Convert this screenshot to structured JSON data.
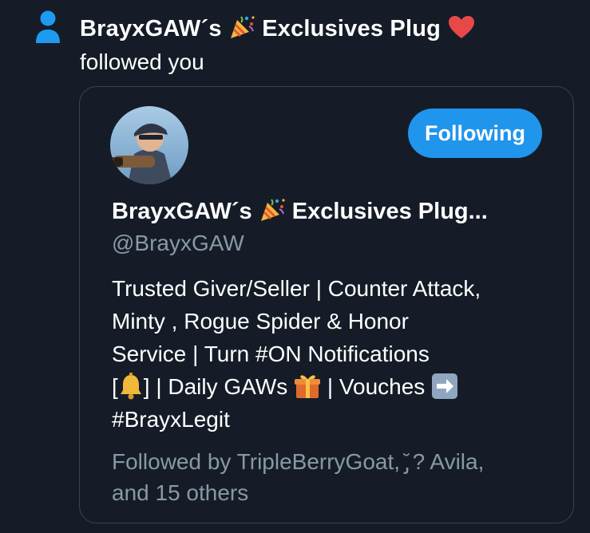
{
  "notification": {
    "icon": "person-icon",
    "name_prefix": "BrayxGAW´s",
    "name_suffix": "Exclusives Plug",
    "action": "followed you"
  },
  "card": {
    "avatar": "profile-avatar",
    "follow_button": "Following",
    "display_name_prefix": "BrayxGAW´s",
    "display_name_suffix": "Exclusives Plug...",
    "handle": "@BrayxGAW",
    "bio_lines": [
      "Trusted Giver/Seller | Counter Attack,",
      "Minty , Rogue Spider & Honor",
      "Service | Turn #ON Notifications",
      "[",
      "] | Daily GAWs",
      "| Vouches",
      "#BrayxLegit"
    ],
    "followed_by_lines": [
      "Followed by TripleBerryGoat, ̡̆ ? Avila,",
      "and 15 others"
    ]
  },
  "colors": {
    "background": "#151c28",
    "accent": "#1f95ec",
    "secondary_text": "#8899a6",
    "border": "#38444d"
  }
}
